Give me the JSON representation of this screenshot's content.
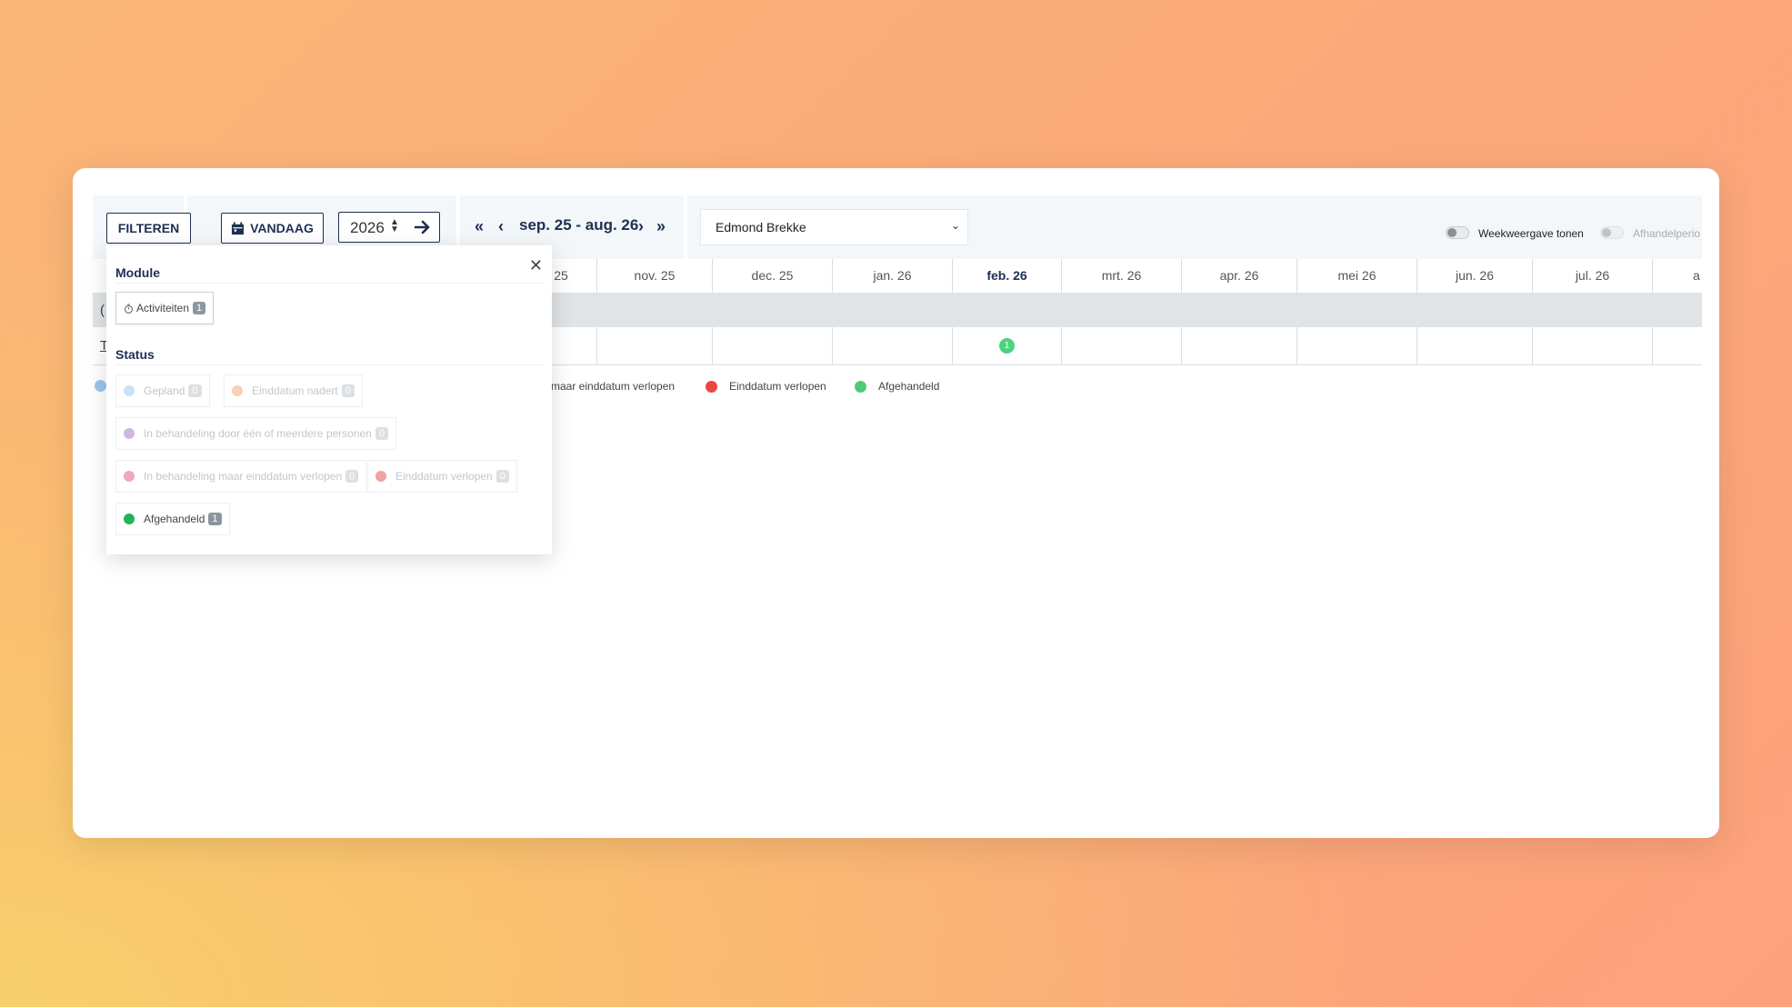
{
  "toolbar": {
    "filter_label": "FILTEREN",
    "today_label": "VANDAAG",
    "year": "2026",
    "range": "sep. 25 - aug. 26",
    "person": "Edmond Brekke",
    "week_toggle_label": "Weekweergave tonen",
    "period_toggle_label": "Afhandelperio"
  },
  "months": [
    "25",
    "nov. 25",
    "dec. 25",
    "jan. 26",
    "feb. 26",
    "mrt. 26",
    "apr. 26",
    "mei 26",
    "jun. 26",
    "jul. 26",
    "a"
  ],
  "current_month": "feb. 26",
  "timeline": {
    "feb_badge": "1",
    "row_peek_1": "(",
    "row_peek_2": "T"
  },
  "legend": [
    {
      "label": "maar einddatum verlopen",
      "color": ""
    },
    {
      "label": "Einddatum verlopen",
      "color": "#ef4444"
    },
    {
      "label": "Afgehandeld",
      "color": "#4fc97a"
    }
  ],
  "popup": {
    "module_title": "Module",
    "status_title": "Status",
    "module_chip": {
      "label": "Activiteiten",
      "count": "1",
      "icon": "stopwatch-icon"
    },
    "status_chips": [
      {
        "label": "Gepland",
        "count": "0",
        "color": "#a8cdf3"
      },
      {
        "label": "Einddatum nadert",
        "count": "0",
        "color": "#f8c4a4"
      },
      {
        "label": "In behandeling door één of meerdere personen",
        "count": "0",
        "color": "#c2a6d8"
      },
      {
        "label": "In behandeling maar einddatum verlopen",
        "count": "0",
        "color": "#eea0b4"
      },
      {
        "label": "Einddatum verlopen",
        "count": "0",
        "color": "#f2a2a2"
      },
      {
        "label": "Afgehandeld",
        "count": "1",
        "color": "#22b457"
      }
    ]
  },
  "colors": {
    "primary": "#1e2f52",
    "toolbar_bg": "#f3f7f9"
  }
}
